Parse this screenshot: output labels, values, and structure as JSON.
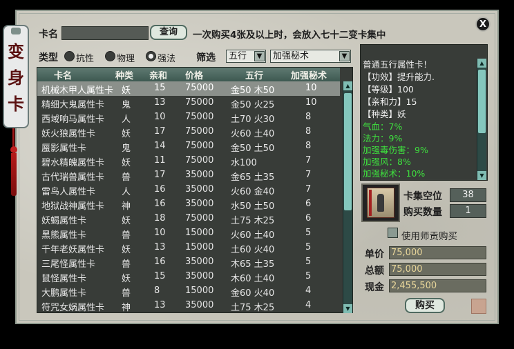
{
  "banner": {
    "chars": [
      "变",
      "身",
      "卡"
    ]
  },
  "close_label": "X",
  "search": {
    "label": "卡名",
    "value": "",
    "button": "查询",
    "notice": "一次购买4张及以上时，会放入七十二变卡集中"
  },
  "type_filter": {
    "label": "类型",
    "options": [
      "抗性",
      "物理",
      "强法"
    ],
    "selected": "强法"
  },
  "screen_filter": {
    "label": "筛选",
    "element": "五行",
    "attribute": "加强秘术"
  },
  "list": {
    "columns": [
      "卡名",
      "种类",
      "亲和",
      "价格",
      "五行",
      "加强秘术"
    ],
    "rows": [
      {
        "name": "机械木甲人属性卡",
        "kind": "妖",
        "affinity": "15",
        "price": "75000",
        "element": "金50 木50",
        "bonus": "10"
      },
      {
        "name": "精细大鬼属性卡",
        "kind": "鬼",
        "affinity": "13",
        "price": "75000",
        "element": "金50 火25",
        "bonus": "10"
      },
      {
        "name": "西域响马属性卡",
        "kind": "人",
        "affinity": "10",
        "price": "75000",
        "element": "土70 火30",
        "bonus": "8"
      },
      {
        "name": "妖火狼属性卡",
        "kind": "妖",
        "affinity": "17",
        "price": "75000",
        "element": "火60 土40",
        "bonus": "8"
      },
      {
        "name": "蜃影属性卡",
        "kind": "鬼",
        "affinity": "14",
        "price": "75000",
        "element": "金50 土50",
        "bonus": "8"
      },
      {
        "name": "碧水精魄属性卡",
        "kind": "妖",
        "affinity": "11",
        "price": "75000",
        "element": "水100",
        "bonus": "7"
      },
      {
        "name": "古代瑞兽属性卡",
        "kind": "兽",
        "affinity": "17",
        "price": "35000",
        "element": "金65 土35",
        "bonus": "7"
      },
      {
        "name": "雷鸟人属性卡",
        "kind": "人",
        "affinity": "16",
        "price": "35000",
        "element": "火60 金40",
        "bonus": "7"
      },
      {
        "name": "地狱战神属性卡",
        "kind": "神",
        "affinity": "16",
        "price": "35000",
        "element": "水50 土50",
        "bonus": "6"
      },
      {
        "name": "妖蝎属性卡",
        "kind": "妖",
        "affinity": "18",
        "price": "75000",
        "element": "土75 木25",
        "bonus": "6"
      },
      {
        "name": "黑熊属性卡",
        "kind": "兽",
        "affinity": "10",
        "price": "15000",
        "element": "火60 土40",
        "bonus": "5"
      },
      {
        "name": "千年老妖属性卡",
        "kind": "妖",
        "affinity": "13",
        "price": "15000",
        "element": "土60 火40",
        "bonus": "5"
      },
      {
        "name": "三尾怪属性卡",
        "kind": "兽",
        "affinity": "16",
        "price": "35000",
        "element": "木65 土35",
        "bonus": "5"
      },
      {
        "name": "鼠怪属性卡",
        "kind": "妖",
        "affinity": "15",
        "price": "35000",
        "element": "木60 土40",
        "bonus": "5"
      },
      {
        "name": "大鹏属性卡",
        "kind": "兽",
        "affinity": "8",
        "price": "15000",
        "element": "金60 火40",
        "bonus": "4"
      },
      {
        "name": "符咒女娲属性卡",
        "kind": "神",
        "affinity": "13",
        "price": "35000",
        "element": "土75 木25",
        "bonus": "4"
      }
    ],
    "selected_index": 0
  },
  "detail": {
    "lines": [
      "普通五行属性卡！",
      "【功效】提升能力.",
      "【等级】100",
      "【亲和力】15",
      "【种类】妖"
    ],
    "stats": [
      "气血：7%",
      "法力：9%",
      "加强毒伤害：9%",
      "加强风：8%",
      "加强秘术：10%"
    ]
  },
  "purchase": {
    "slots_label": "卡集空位",
    "slots_value": "38",
    "qty_label": "购买数量",
    "qty_value": "1",
    "mentor_label": "使用师贡购买",
    "unit_label": "单价",
    "unit_value": "75,000",
    "total_label": "总额",
    "total_value": "75,000",
    "cash_label": "现金",
    "cash_value": "2,455,500",
    "buy_button": "购买"
  }
}
